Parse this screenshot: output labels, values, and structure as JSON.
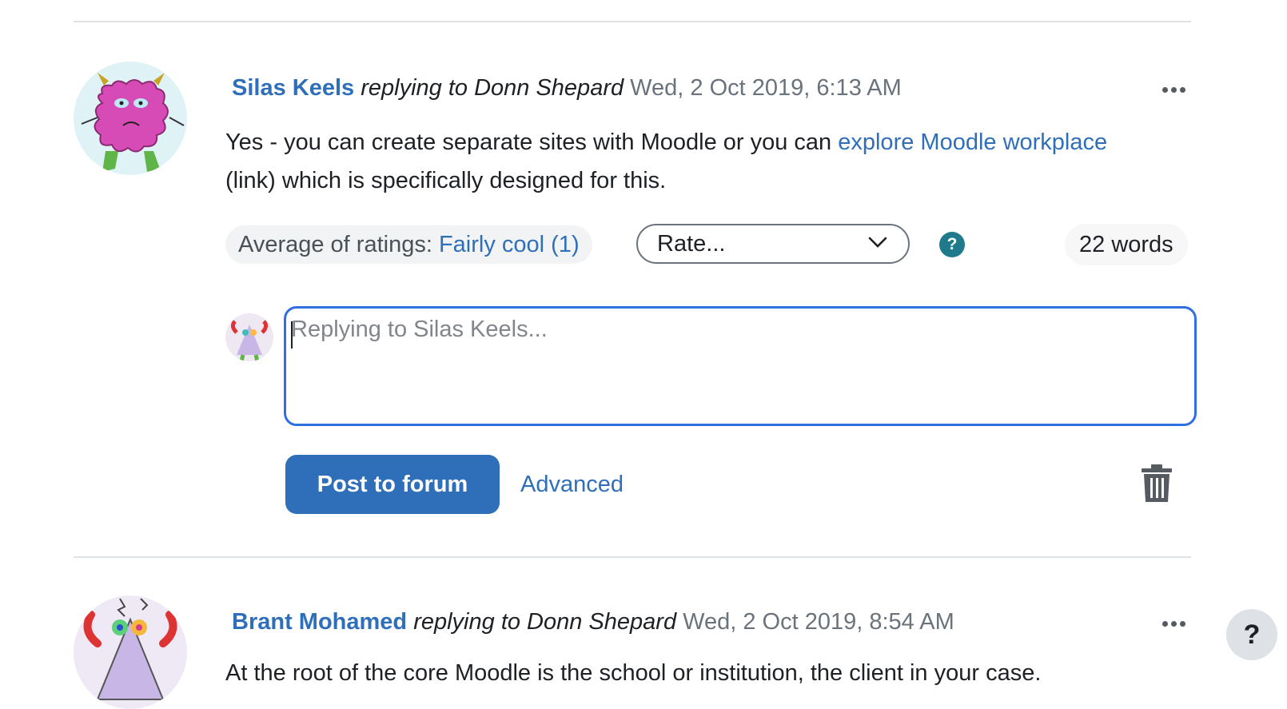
{
  "post1": {
    "author": "Silas Keels",
    "replying": "replying to Donn Shepard",
    "date": "Wed, 2 Oct 2019, 6:13 AM",
    "body_before": "Yes - you can create separate sites with Moodle or you can ",
    "link_text": "explore Moodle workplace",
    "body_after": " (link) which is specifically designed for this.",
    "rating_label": "Average of ratings: ",
    "rating_value": "Fairly cool (1)",
    "rate_select": "Rate...",
    "help_glyph": "?",
    "word_count": "22 words"
  },
  "reply": {
    "placeholder": "Replying to Silas Keels...",
    "post_button": "Post to forum",
    "advanced_link": "Advanced"
  },
  "post2": {
    "author": "Brant Mohamed",
    "replying": "replying to Donn Shepard",
    "date": "Wed, 2 Oct 2019, 8:54 AM",
    "body": "At the root of the core Moodle is the school or institution, the client in your case."
  },
  "floating_help": "?",
  "icons": {
    "more": "more-horizontal-icon",
    "chevron": "chevron-down-icon",
    "help": "question-circle-icon",
    "trash": "trash-icon"
  },
  "colors": {
    "link": "#2f6fb9",
    "primary_button": "#2f6fb9",
    "focus_border": "#2f6fe0",
    "help_icon": "#1f7a8c"
  }
}
